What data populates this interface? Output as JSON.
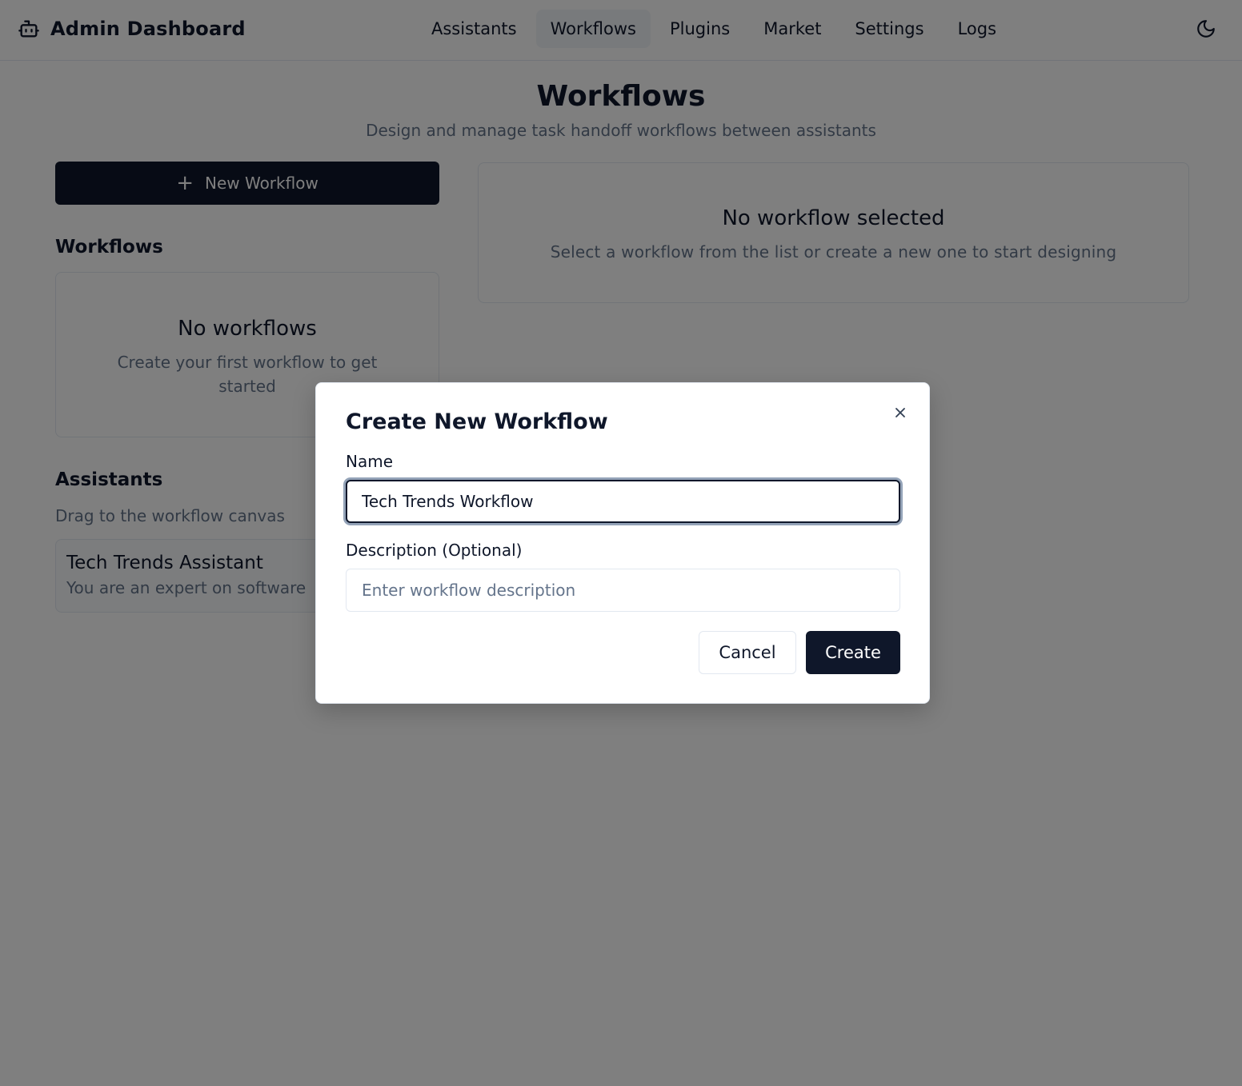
{
  "header": {
    "title": "Admin Dashboard",
    "logo_icon": "robot-icon",
    "nav": [
      {
        "label": "Assistants",
        "active": false
      },
      {
        "label": "Workflows",
        "active": true
      },
      {
        "label": "Plugins",
        "active": false
      },
      {
        "label": "Market",
        "active": false
      },
      {
        "label": "Settings",
        "active": false
      },
      {
        "label": "Logs",
        "active": false
      }
    ],
    "theme_icon": "moon-icon"
  },
  "page": {
    "title": "Workflows",
    "subtitle": "Design and manage task handoff workflows between assistants"
  },
  "sidebar": {
    "new_button_icon": "+",
    "new_button_label": "New Workflow",
    "workflows_heading": "Workflows",
    "empty_title": "No workflows",
    "empty_desc": "Create your first workflow to get started",
    "assistants_heading": "Assistants",
    "assistants_hint": "Drag to the workflow canvas",
    "assistants": [
      {
        "name": "Tech Trends Assistant",
        "prompt": "You are an expert on software"
      }
    ]
  },
  "canvas": {
    "empty_title": "No workflow selected",
    "empty_desc": "Select a workflow from the list or create a new one to start designing"
  },
  "dialog": {
    "title": "Create New Workflow",
    "close_icon": "close-icon",
    "name_label": "Name",
    "name_value": "Tech Trends Workflow",
    "description_label": "Description (Optional)",
    "description_value": "",
    "description_placeholder": "Enter workflow description",
    "cancel_label": "Cancel",
    "create_label": "Create"
  },
  "colors": {
    "primary": "#0f172a",
    "muted_text": "#64748b",
    "border": "#e2e8f0",
    "overlay": "rgba(0,0,0,0.5)"
  }
}
